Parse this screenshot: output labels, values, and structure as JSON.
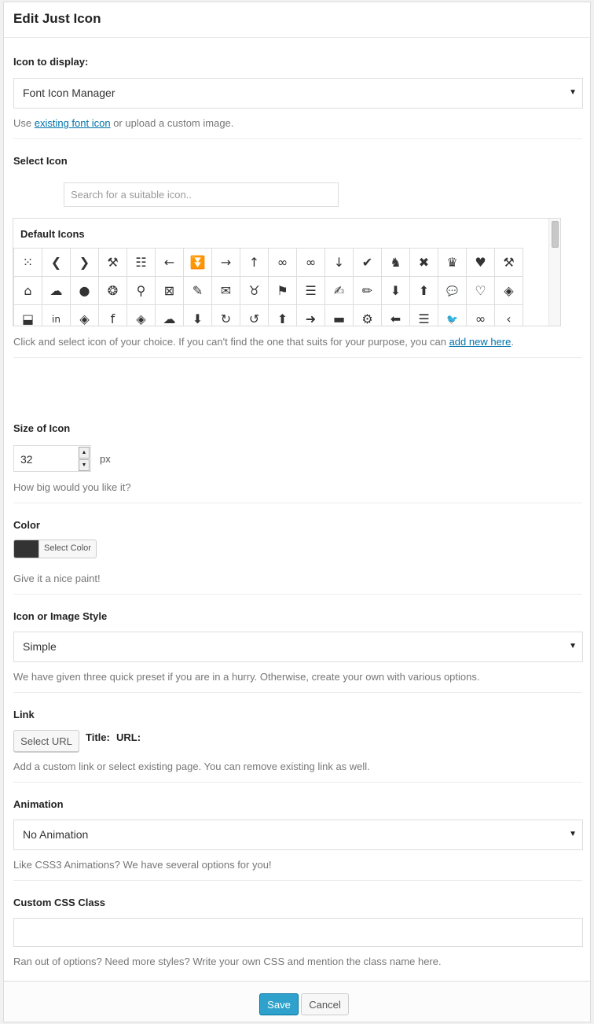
{
  "dialog": {
    "title": "Edit Just Icon"
  },
  "icon_display": {
    "label": "Icon to display:",
    "selected": "Font Icon Manager",
    "help_pre": "Use ",
    "help_link": "existing font icon",
    "help_post": " or upload a custom image."
  },
  "select_icon": {
    "label": "Select Icon",
    "search_placeholder": "Search for a suitable icon..",
    "group_title": "Default Icons",
    "help_pre": "Click and select icon of your choice. If you can't find the one that suits for your purpose, you can ",
    "help_link": "add new here",
    "help_post": ".",
    "icons": [
      {
        "name": "grid-dots-icon",
        "glyph": "⁙"
      },
      {
        "name": "chevron-left-icon",
        "glyph": "❮"
      },
      {
        "name": "chevron-right-icon",
        "glyph": "❯"
      },
      {
        "name": "gavel-icon",
        "glyph": "⚒"
      },
      {
        "name": "equalizer-icon",
        "glyph": "☷"
      },
      {
        "name": "arrow-left-icon",
        "glyph": "←"
      },
      {
        "name": "double-chevron-down-icon",
        "glyph": "⏬"
      },
      {
        "name": "arrow-right-icon",
        "glyph": "→"
      },
      {
        "name": "arrow-up-icon",
        "glyph": "↑"
      },
      {
        "name": "glasses-icon",
        "glyph": "∞"
      },
      {
        "name": "glasses-outline-icon",
        "glyph": "∞"
      },
      {
        "name": "arrow-down-icon",
        "glyph": "↓"
      },
      {
        "name": "checkmark-icon",
        "glyph": "✔"
      },
      {
        "name": "chess-knight-icon",
        "glyph": "♞"
      },
      {
        "name": "close-icon",
        "glyph": "✖"
      },
      {
        "name": "chess-queen-icon",
        "glyph": "♛"
      },
      {
        "name": "heart-icon",
        "glyph": "♥"
      },
      {
        "name": "hammer-icon",
        "glyph": "⚒"
      },
      {
        "name": "home-icon",
        "glyph": "⌂"
      },
      {
        "name": "chat-bubbles-icon",
        "glyph": "☁"
      },
      {
        "name": "user-icon",
        "glyph": "●"
      },
      {
        "name": "aperture-icon",
        "glyph": "❂"
      },
      {
        "name": "search-icon",
        "glyph": "⚲"
      },
      {
        "name": "zoom-icon",
        "glyph": "⊠"
      },
      {
        "name": "brush-icon",
        "glyph": "✎"
      },
      {
        "name": "envelope-icon",
        "glyph": "✉"
      },
      {
        "name": "bull-head-icon",
        "glyph": "♉"
      },
      {
        "name": "tags-icon",
        "glyph": "⚑"
      },
      {
        "name": "stack-outline-icon",
        "glyph": "☰"
      },
      {
        "name": "edit-note-icon",
        "glyph": "✍"
      },
      {
        "name": "pencil-icon",
        "glyph": "✏"
      },
      {
        "name": "circle-down-icon",
        "glyph": "⬇"
      },
      {
        "name": "circle-up-icon",
        "glyph": "⬆"
      },
      {
        "name": "speech-bubble-icon",
        "glyph": "💬"
      },
      {
        "name": "heart-outline-icon",
        "glyph": "♡"
      },
      {
        "name": "layers-icon",
        "glyph": "◈"
      },
      {
        "name": "inbox-download-icon",
        "glyph": "⬓"
      },
      {
        "name": "linkedin-icon",
        "glyph": "in"
      },
      {
        "name": "layers-alt-icon",
        "glyph": "◈"
      },
      {
        "name": "facebook-icon",
        "glyph": "f"
      },
      {
        "name": "stack-icon",
        "glyph": "◈"
      },
      {
        "name": "comments-icon",
        "glyph": "☁"
      },
      {
        "name": "circle-arrow-down-icon",
        "glyph": "⬇"
      },
      {
        "name": "circle-rotate-right-icon",
        "glyph": "↻"
      },
      {
        "name": "circle-rotate-left-icon",
        "glyph": "↺"
      },
      {
        "name": "circle-arrow-up-icon",
        "glyph": "⬆"
      },
      {
        "name": "circle-arrow-right-icon",
        "glyph": "➜"
      },
      {
        "name": "drive-icon",
        "glyph": "▬"
      },
      {
        "name": "gears-icon",
        "glyph": "⚙"
      },
      {
        "name": "circle-arrow-left-icon",
        "glyph": "⬅"
      },
      {
        "name": "sliders-icon",
        "glyph": "☰"
      },
      {
        "name": "twitter-icon",
        "glyph": "🐦"
      },
      {
        "name": "link-icon",
        "glyph": "∞"
      },
      {
        "name": "angle-left-icon",
        "glyph": "‹"
      }
    ]
  },
  "size": {
    "label": "Size of Icon",
    "value": "32",
    "unit": "px",
    "help": "How big would you like it?"
  },
  "color": {
    "label": "Color",
    "button": "Select Color",
    "swatch": "#333333",
    "help": "Give it a nice paint!"
  },
  "style": {
    "label": "Icon or Image Style",
    "selected": "Simple",
    "help": "We have given three quick preset if you are in a hurry. Otherwise, create your own with various options."
  },
  "link": {
    "label": "Link",
    "button": "Select URL",
    "title_label": "Title:",
    "url_label": "URL:",
    "help": "Add a custom link or select existing page. You can remove existing link as well."
  },
  "animation": {
    "label": "Animation",
    "selected": "No Animation",
    "help": "Like CSS3 Animations? We have several options for you!"
  },
  "css_class": {
    "label": "Custom CSS Class",
    "value": "",
    "help": "Ran out of options? Need more styles? Write your own CSS and mention the class name here."
  },
  "footer": {
    "save": "Save",
    "cancel": "Cancel"
  },
  "colors": {
    "accent": "#2ea2cc",
    "link": "#0073aa"
  }
}
